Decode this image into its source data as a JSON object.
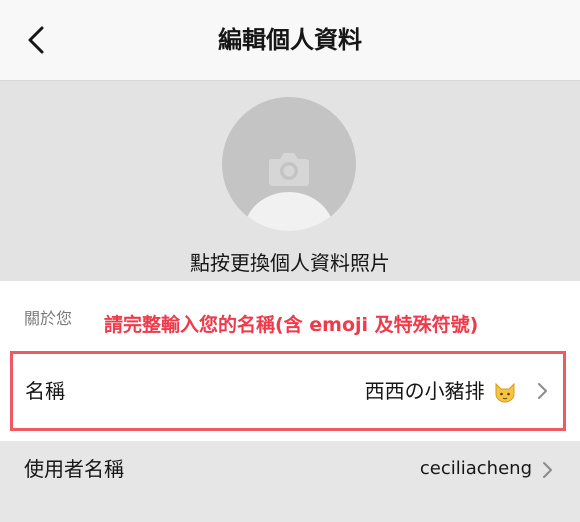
{
  "header": {
    "title": "編輯個人資料",
    "back_icon": "chevron-left-icon"
  },
  "avatar": {
    "icon": "camera-icon",
    "change_label": "點按更換個人資料照片"
  },
  "about": {
    "section_label": "關於您",
    "warning": "請完整輸入您的名稱(含 emoji 及特殊符號)",
    "warning_color": "#ee3a4b",
    "highlight_color": "#ee5a63"
  },
  "name_row": {
    "label": "名稱",
    "value": "西西の小豬排",
    "emoji_icon": "cat-face-icon"
  },
  "username_row": {
    "label": "使用者名稱",
    "value": "ceciliacheng"
  }
}
